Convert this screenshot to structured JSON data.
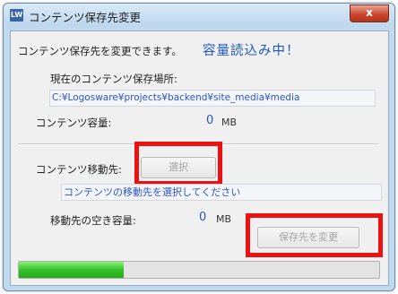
{
  "window": {
    "title": "コンテンツ保存先変更",
    "icon_text": "LW",
    "close_glyph": "x"
  },
  "info_text": "コンテンツ保存先を変更できます。",
  "status_text": "容量読込み中！",
  "current_location": {
    "label": "現在のコンテンツ保存場所:",
    "path": "C:¥Logosware¥projects¥backend¥site_media¥media"
  },
  "content_size": {
    "label": "コンテンツ容量:",
    "value": "0",
    "unit": "MB"
  },
  "destination": {
    "label": "コンテンツ移動先:",
    "select_button": "選択",
    "placeholder": "コンテンツの移動先を選択してください"
  },
  "free_space": {
    "label": "移動先の空き容量:",
    "value": "0",
    "unit": "MB"
  },
  "change_button": "保存先を変更",
  "progress": {
    "fraction": 0.29
  },
  "colors": {
    "highlight": "#ee1111",
    "accent_text": "#2a55c2",
    "status_text": "#1f57c6",
    "progress_fill": "#37c12b",
    "close_button": "#c8472d"
  },
  "icons": [
    "app-icon",
    "close-icon"
  ]
}
